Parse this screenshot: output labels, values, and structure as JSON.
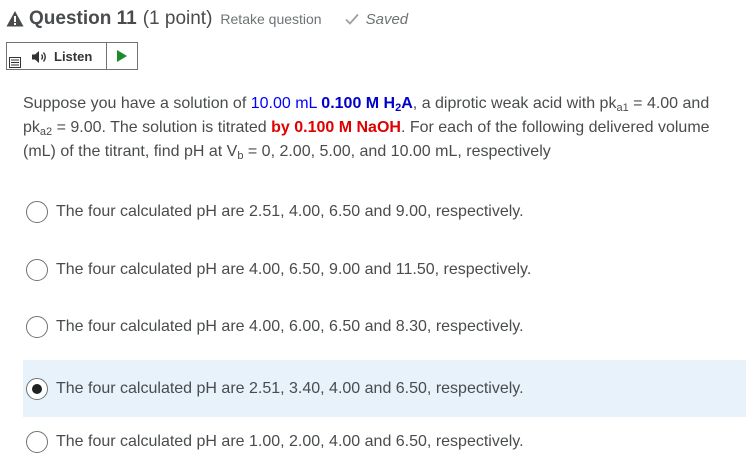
{
  "header": {
    "title": "Question 11",
    "points": "(1 point)",
    "retake": "Retake question",
    "saved": "Saved"
  },
  "listen": {
    "label": "Listen"
  },
  "question": {
    "t1": "Suppose you have a solution of ",
    "vol": "10.00 mL",
    "conc_prefix": "0.100 M H",
    "conc_sub": "2",
    "conc_suffix": "A",
    "t2": ", a diprotic weak acid with pk",
    "a1_sub": "a1",
    "t3": " = 4.00 and pk",
    "a2_sub": "a2",
    "t4": " = 9.00. The solution is titrated ",
    "titrant": "by 0.100 M NaOH",
    "t5": ". For each of the following delivered volume (mL) of the titrant, find pH at V",
    "vb_sub": "b",
    "t6": " = 0, 2.00, 5.00, and 10.00 mL, respectively"
  },
  "options": [
    {
      "label": "The four calculated pH are 2.51, 4.00, 6.50 and 9.00, respectively.",
      "selected": false
    },
    {
      "label": "The four calculated pH are 4.00, 6.50, 9.00 and 11.50, respectively.",
      "selected": false
    },
    {
      "label": "The four calculated pH are 4.00, 6.00, 6.50 and 8.30, respectively.",
      "selected": false
    },
    {
      "label": "The four calculated pH are 2.51, 3.40, 4.00 and 6.50, respectively.",
      "selected": true
    },
    {
      "label": "The four calculated pH are 1.00, 2.00, 4.00 and 6.50, respectively.",
      "selected": false
    }
  ],
  "colors": {
    "accent_blue": "#0000ff",
    "titrant_red": "#e00000",
    "selected_bg": "#e7f2fb",
    "play_green": "#1e8a2e"
  }
}
